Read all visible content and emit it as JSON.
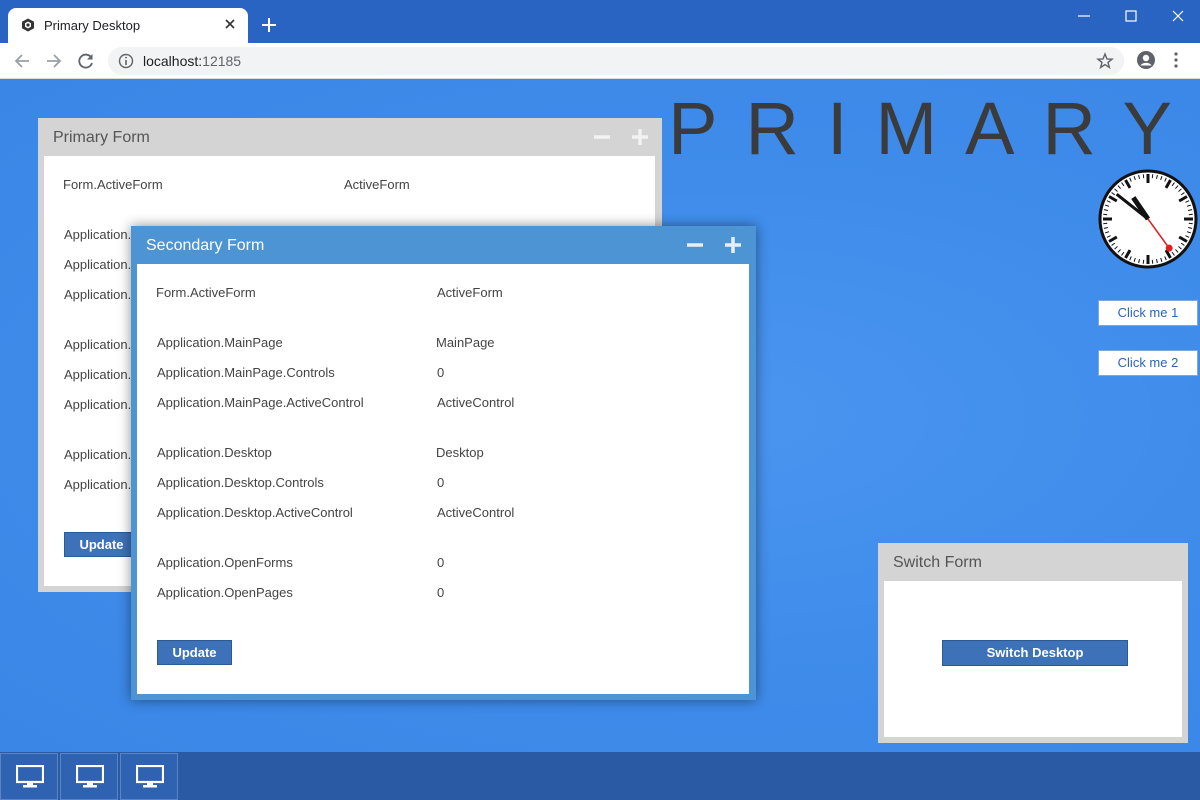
{
  "browser": {
    "tab_title": "Primary Desktop",
    "url_host": "localhost:",
    "url_port": "12185"
  },
  "desktop": {
    "title": "PRIMARY",
    "buttons": [
      "Click me 1",
      "Click me 2"
    ],
    "clock_time": "10:51:24"
  },
  "primary_form": {
    "title": "Primary Form",
    "rows": [
      {
        "label": "Form.ActiveForm",
        "value": "ActiveForm"
      },
      {
        "label": "Application.",
        "value": ""
      },
      {
        "label": "Application.",
        "value": ""
      },
      {
        "label": "Application.",
        "value": ""
      },
      {
        "label": "Application.",
        "value": ""
      },
      {
        "label": "Application.",
        "value": ""
      },
      {
        "label": "Application.",
        "value": ""
      },
      {
        "label": "Application.",
        "value": ""
      },
      {
        "label": "Application.",
        "value": ""
      }
    ],
    "update_label": "Update"
  },
  "secondary_form": {
    "title": "Secondary Form",
    "rows": [
      {
        "label": "Form.ActiveForm",
        "value": "ActiveForm"
      },
      {
        "label": "Application.MainPage",
        "value": "MainPage"
      },
      {
        "label": "Application.MainPage.Controls",
        "value": "0"
      },
      {
        "label": "Application.MainPage.ActiveControl",
        "value": "ActiveControl"
      },
      {
        "label": "Application.Desktop",
        "value": "Desktop"
      },
      {
        "label": "Application.Desktop.Controls",
        "value": "0"
      },
      {
        "label": "Application.Desktop.ActiveControl",
        "value": "ActiveControl"
      },
      {
        "label": "Application.OpenForms",
        "value": "0"
      },
      {
        "label": "Application.OpenPages",
        "value": "0"
      }
    ],
    "update_label": "Update"
  },
  "switch_form": {
    "title": "Switch Form",
    "button_label": "Switch Desktop"
  },
  "taskbar": {
    "items": [
      "monitor-icon",
      "monitor-icon",
      "monitor-icon"
    ]
  },
  "colors": {
    "desktop_bg": "#3d8bea",
    "secondary_header": "#4d94d4",
    "button_blue": "#3d72b8",
    "taskbar": "#2b5aa5"
  }
}
